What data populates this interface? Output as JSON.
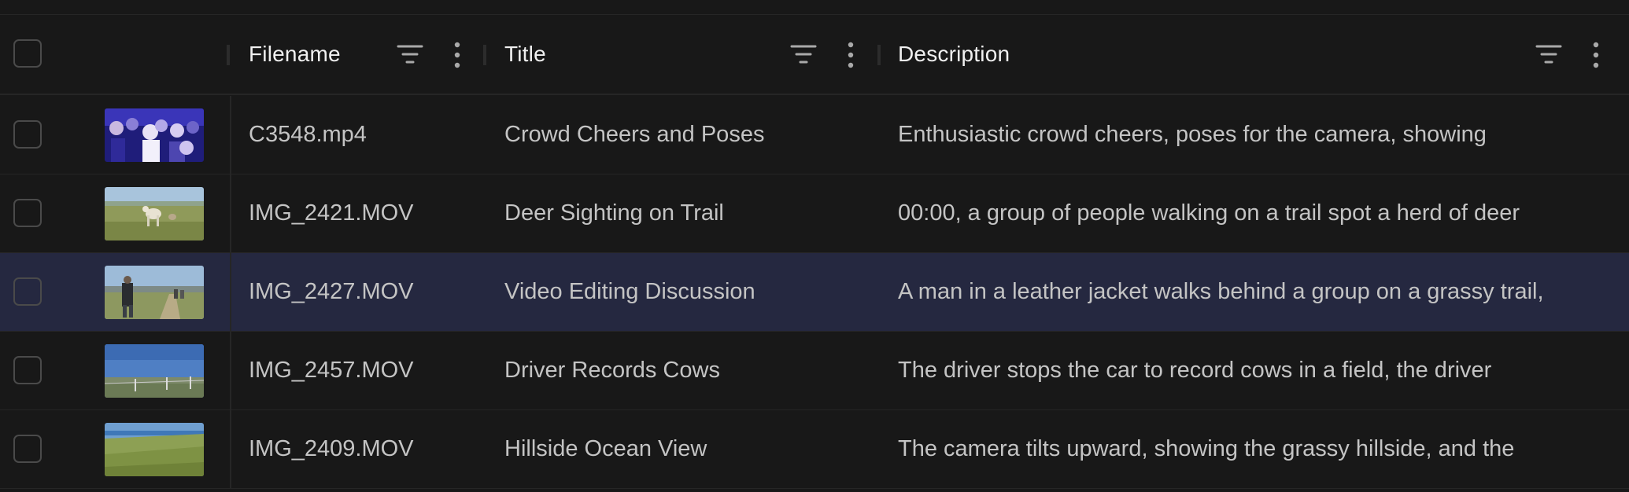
{
  "columns": {
    "filename": "Filename",
    "title": "Title",
    "description": "Description"
  },
  "icons": {
    "filter": "filter-icon",
    "more": "more-vertical-icon"
  },
  "rows": [
    {
      "filename": "C3548.mp4",
      "title": "Crowd Cheers and Poses",
      "description": "Enthusiastic crowd cheers, poses for the camera, showing",
      "thumbnail": "crowd-thumbnail",
      "selected": false
    },
    {
      "filename": "IMG_2421.MOV",
      "title": "Deer Sighting on Trail",
      "description": "00:00, a group of people walking on a trail spot a herd of deer",
      "thumbnail": "deer-thumbnail",
      "selected": false
    },
    {
      "filename": "IMG_2427.MOV",
      "title": "Video Editing Discussion",
      "description": "A man in a leather jacket walks behind a group on a grassy trail,",
      "thumbnail": "trail-man-thumbnail",
      "selected": true
    },
    {
      "filename": "IMG_2457.MOV",
      "title": "Driver Records Cows",
      "description": "The driver stops the car to record cows in a field, the driver",
      "thumbnail": "cows-field-thumbnail",
      "selected": false
    },
    {
      "filename": "IMG_2409.MOV",
      "title": "Hillside Ocean View",
      "description": "The camera tilts upward, showing the grassy hillside, and the",
      "thumbnail": "hillside-ocean-thumbnail",
      "selected": false
    }
  ],
  "colors": {
    "background": "#181818",
    "selected_row": "#252840",
    "header_text": "#f0f0f0",
    "cell_text": "#c4c4c4"
  }
}
